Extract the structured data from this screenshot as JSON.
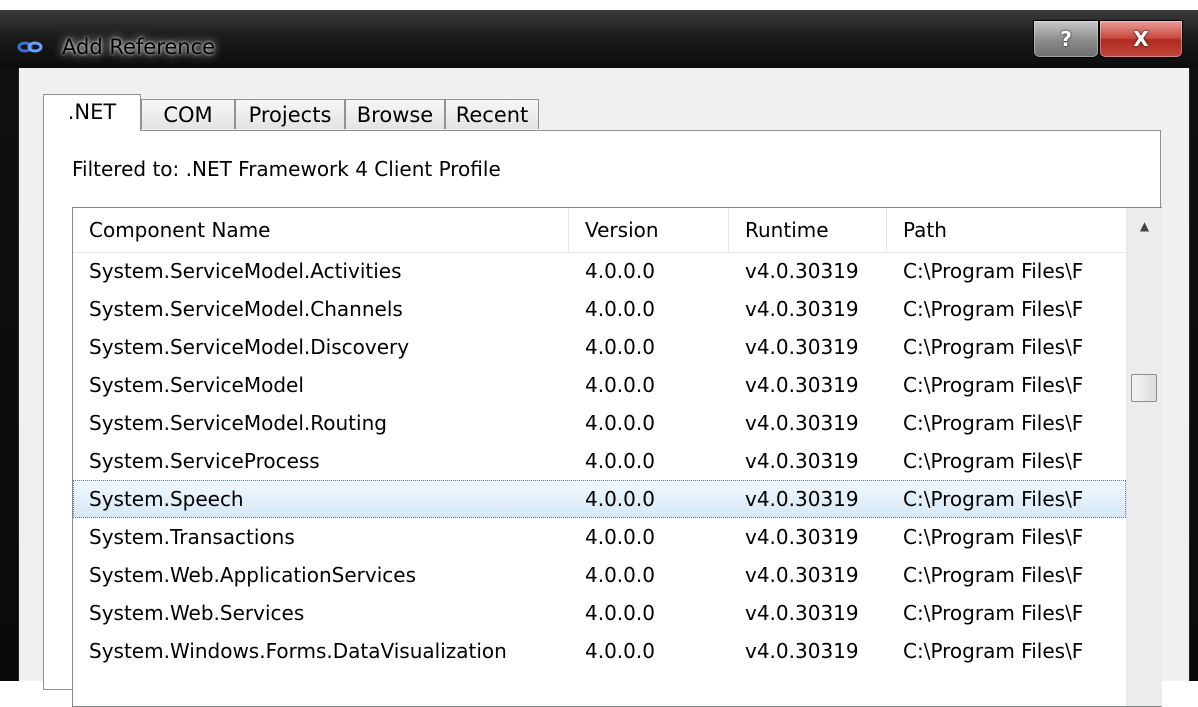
{
  "window": {
    "title": "Add Reference",
    "icon": "link-reference-icon",
    "help_label": "?",
    "close_label": "X"
  },
  "tabs": [
    {
      "label": ".NET",
      "active": true
    },
    {
      "label": "COM",
      "active": false
    },
    {
      "label": "Projects",
      "active": false
    },
    {
      "label": "Browse",
      "active": false
    },
    {
      "label": "Recent",
      "active": false
    }
  ],
  "filter_text": "Filtered to: .NET Framework 4 Client Profile",
  "table": {
    "columns": [
      "Component Name",
      "Version",
      "Runtime",
      "Path"
    ],
    "rows": [
      [
        "System.ServiceModel.Activities",
        "4.0.0.0",
        "v4.0.30319",
        "C:\\Program Files\\F"
      ],
      [
        "System.ServiceModel.Channels",
        "4.0.0.0",
        "v4.0.30319",
        "C:\\Program Files\\F"
      ],
      [
        "System.ServiceModel.Discovery",
        "4.0.0.0",
        "v4.0.30319",
        "C:\\Program Files\\F"
      ],
      [
        "System.ServiceModel",
        "4.0.0.0",
        "v4.0.30319",
        "C:\\Program Files\\F"
      ],
      [
        "System.ServiceModel.Routing",
        "4.0.0.0",
        "v4.0.30319",
        "C:\\Program Files\\F"
      ],
      [
        "System.ServiceProcess",
        "4.0.0.0",
        "v4.0.30319",
        "C:\\Program Files\\F"
      ],
      [
        "System.Speech",
        "4.0.0.0",
        "v4.0.30319",
        "C:\\Program Files\\F"
      ],
      [
        "System.Transactions",
        "4.0.0.0",
        "v4.0.30319",
        "C:\\Program Files\\F"
      ],
      [
        "System.Web.ApplicationServices",
        "4.0.0.0",
        "v4.0.30319",
        "C:\\Program Files\\F"
      ],
      [
        "System.Web.Services",
        "4.0.0.0",
        "v4.0.30319",
        "C:\\Program Files\\F"
      ],
      [
        "System.Windows.Forms.DataVisualization",
        "4.0.0.0",
        "v4.0.30319",
        "C:\\Program Files\\F"
      ]
    ],
    "selected_row": 6
  },
  "colors": {
    "selection": "#d5e8f7",
    "close_button": "#c9463d"
  }
}
